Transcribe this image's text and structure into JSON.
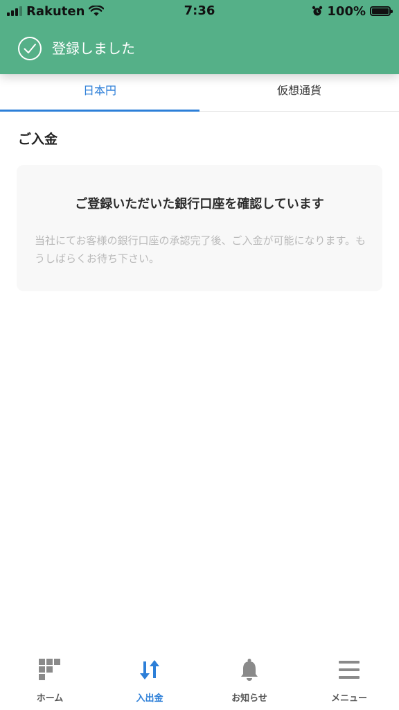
{
  "status_bar": {
    "carrier": "Rakuten",
    "time": "7:36",
    "battery": "100%"
  },
  "toast": {
    "message": "登録しました",
    "icon": "check-circle-icon"
  },
  "tabs": [
    {
      "label": "日本円",
      "active": true
    },
    {
      "label": "仮想通貨",
      "active": false
    }
  ],
  "section": {
    "title": "ご入金"
  },
  "card": {
    "heading": "ご登録いただいた銀行口座を確認しています",
    "body": "当社にてお客様の銀行口座の承認完了後、ご入金が可能になります。もうしばらくお待ち下さい。"
  },
  "bottom_nav": [
    {
      "label": "ホーム",
      "icon": "home-grid-icon",
      "active": false
    },
    {
      "label": "入出金",
      "icon": "deposit-withdraw-icon",
      "active": true
    },
    {
      "label": "お知らせ",
      "icon": "bell-icon",
      "active": false
    },
    {
      "label": "メニュー",
      "icon": "menu-icon",
      "active": false
    }
  ],
  "colors": {
    "toast_green": "#55b088",
    "accent_blue": "#2d7fd8",
    "inactive_gray": "#8a8a8a"
  }
}
